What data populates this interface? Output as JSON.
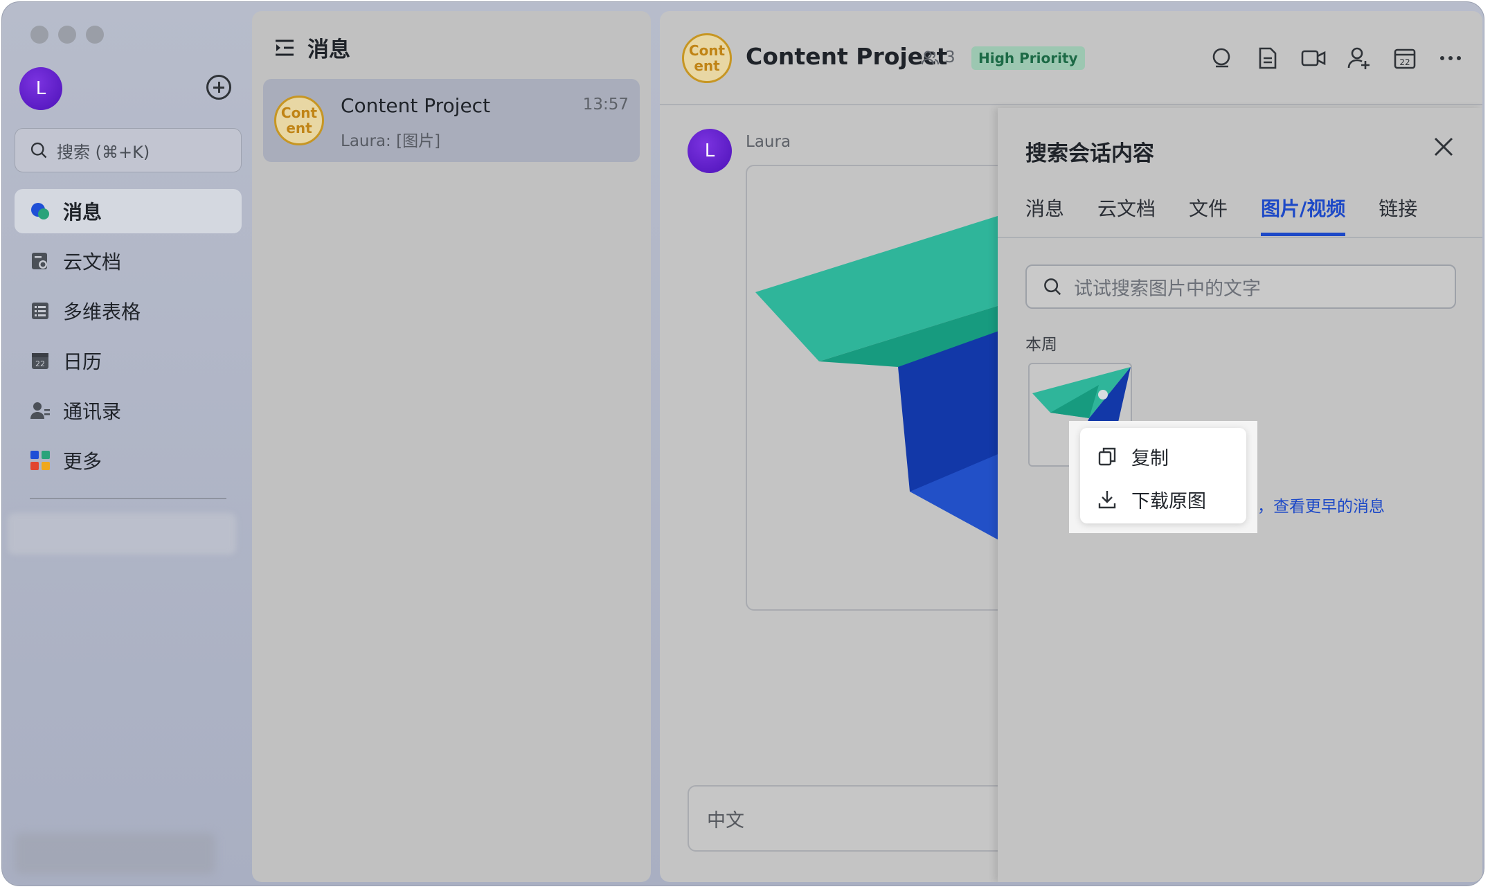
{
  "sidebar": {
    "avatar_letter": "L",
    "search_placeholder": "搜索 (⌘+K)",
    "nav": [
      {
        "label": "消息",
        "icon": "chat-bubble-icon",
        "active": true
      },
      {
        "label": "云文档",
        "icon": "cloud-doc-icon",
        "active": false
      },
      {
        "label": "多维表格",
        "icon": "base-table-icon",
        "active": false
      },
      {
        "label": "日历",
        "icon": "calendar-icon",
        "active": false
      },
      {
        "label": "通讯录",
        "icon": "contacts-icon",
        "active": false
      },
      {
        "label": "更多",
        "icon": "apps-grid-icon",
        "active": false
      }
    ]
  },
  "chat_list": {
    "header": "消息",
    "items": [
      {
        "avatar_text": "Cont ent",
        "name": "Content Project",
        "time": "13:57",
        "preview": "Laura: [图片]"
      }
    ]
  },
  "conversation": {
    "avatar_text": "Cont ent",
    "title": "Content Project",
    "member_count": "3",
    "badge": "High Priority",
    "badge_color": "#1c6a46",
    "message": {
      "sender_letter": "L",
      "sender": "Laura"
    },
    "composer_text": "中文"
  },
  "search_panel": {
    "title": "搜索会话内容",
    "tabs": [
      {
        "label": "消息",
        "active": false
      },
      {
        "label": "云文档",
        "active": false
      },
      {
        "label": "文件",
        "active": false
      },
      {
        "label": "图片/视频",
        "active": true
      },
      {
        "label": "链接",
        "active": false
      }
    ],
    "input_placeholder": "试试搜索图片中的文字",
    "section": "本周",
    "more_link": "息，查看更早的消息",
    "accent_color": "#1d49c7"
  },
  "context_menu": {
    "items": [
      {
        "label": "复制",
        "icon": "copy-icon"
      },
      {
        "label": "下载原图",
        "icon": "download-icon"
      }
    ]
  }
}
